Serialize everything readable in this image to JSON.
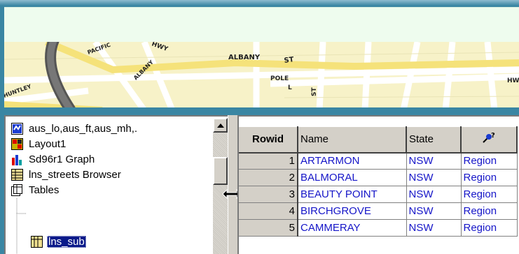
{
  "map": {
    "labels": [
      "ALBANY",
      "ST",
      "POLE",
      "L",
      "ST",
      "ALBANY",
      "PACIFIC",
      "HWY",
      "HUNTLEY",
      "HW"
    ]
  },
  "tree": {
    "items": [
      {
        "label": "aus_lo,aus_ft,aus_mh,.",
        "icon": "map-window-icon"
      },
      {
        "label": "Layout1",
        "icon": "layout-icon"
      },
      {
        "label": "Sd96r1 Graph",
        "icon": "graph-icon"
      },
      {
        "label": "lns_streets Browser",
        "icon": "browser-icon"
      },
      {
        "label": "Tables",
        "icon": "tables-icon"
      },
      {
        "label": "lns_sub",
        "icon": "table-icon",
        "selected": true
      }
    ]
  },
  "browser": {
    "columns": [
      "Rowid",
      "Name",
      "State",
      "?"
    ],
    "rows": [
      {
        "rowid": "1",
        "name": "ARTARMON",
        "state": "NSW",
        "region": "Region"
      },
      {
        "rowid": "2",
        "name": "BALMORAL",
        "state": "NSW",
        "region": "Region"
      },
      {
        "rowid": "3",
        "name": "BEAUTY POINT",
        "state": "NSW",
        "region": "Region"
      },
      {
        "rowid": "4",
        "name": "BIRCHGROVE",
        "state": "NSW",
        "region": "Region"
      },
      {
        "rowid": "5",
        "name": "CAMMERAY",
        "state": "NSW",
        "region": "Region"
      }
    ]
  },
  "colors": {
    "frame": "#3a86a3",
    "banner": "#eefcee",
    "map_bg": "#f7f2c8",
    "selection": "#0a1a8a",
    "link": "#1515c8"
  }
}
